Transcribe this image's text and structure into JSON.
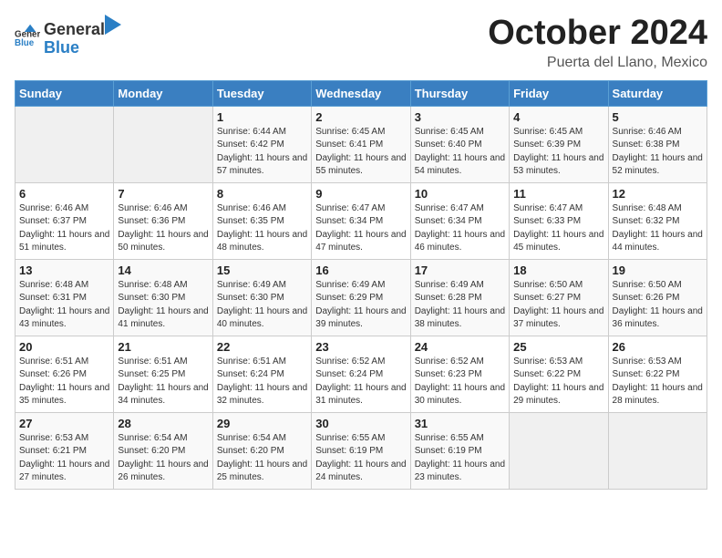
{
  "header": {
    "logo_general": "General",
    "logo_blue": "Blue",
    "month_title": "October 2024",
    "location": "Puerta del Llano, Mexico"
  },
  "weekdays": [
    "Sunday",
    "Monday",
    "Tuesday",
    "Wednesday",
    "Thursday",
    "Friday",
    "Saturday"
  ],
  "weeks": [
    [
      {
        "day": "",
        "info": ""
      },
      {
        "day": "",
        "info": ""
      },
      {
        "day": "1",
        "info": "Sunrise: 6:44 AM\nSunset: 6:42 PM\nDaylight: 11 hours and 57 minutes."
      },
      {
        "day": "2",
        "info": "Sunrise: 6:45 AM\nSunset: 6:41 PM\nDaylight: 11 hours and 55 minutes."
      },
      {
        "day": "3",
        "info": "Sunrise: 6:45 AM\nSunset: 6:40 PM\nDaylight: 11 hours and 54 minutes."
      },
      {
        "day": "4",
        "info": "Sunrise: 6:45 AM\nSunset: 6:39 PM\nDaylight: 11 hours and 53 minutes."
      },
      {
        "day": "5",
        "info": "Sunrise: 6:46 AM\nSunset: 6:38 PM\nDaylight: 11 hours and 52 minutes."
      }
    ],
    [
      {
        "day": "6",
        "info": "Sunrise: 6:46 AM\nSunset: 6:37 PM\nDaylight: 11 hours and 51 minutes."
      },
      {
        "day": "7",
        "info": "Sunrise: 6:46 AM\nSunset: 6:36 PM\nDaylight: 11 hours and 50 minutes."
      },
      {
        "day": "8",
        "info": "Sunrise: 6:46 AM\nSunset: 6:35 PM\nDaylight: 11 hours and 48 minutes."
      },
      {
        "day": "9",
        "info": "Sunrise: 6:47 AM\nSunset: 6:34 PM\nDaylight: 11 hours and 47 minutes."
      },
      {
        "day": "10",
        "info": "Sunrise: 6:47 AM\nSunset: 6:34 PM\nDaylight: 11 hours and 46 minutes."
      },
      {
        "day": "11",
        "info": "Sunrise: 6:47 AM\nSunset: 6:33 PM\nDaylight: 11 hours and 45 minutes."
      },
      {
        "day": "12",
        "info": "Sunrise: 6:48 AM\nSunset: 6:32 PM\nDaylight: 11 hours and 44 minutes."
      }
    ],
    [
      {
        "day": "13",
        "info": "Sunrise: 6:48 AM\nSunset: 6:31 PM\nDaylight: 11 hours and 43 minutes."
      },
      {
        "day": "14",
        "info": "Sunrise: 6:48 AM\nSunset: 6:30 PM\nDaylight: 11 hours and 41 minutes."
      },
      {
        "day": "15",
        "info": "Sunrise: 6:49 AM\nSunset: 6:30 PM\nDaylight: 11 hours and 40 minutes."
      },
      {
        "day": "16",
        "info": "Sunrise: 6:49 AM\nSunset: 6:29 PM\nDaylight: 11 hours and 39 minutes."
      },
      {
        "day": "17",
        "info": "Sunrise: 6:49 AM\nSunset: 6:28 PM\nDaylight: 11 hours and 38 minutes."
      },
      {
        "day": "18",
        "info": "Sunrise: 6:50 AM\nSunset: 6:27 PM\nDaylight: 11 hours and 37 minutes."
      },
      {
        "day": "19",
        "info": "Sunrise: 6:50 AM\nSunset: 6:26 PM\nDaylight: 11 hours and 36 minutes."
      }
    ],
    [
      {
        "day": "20",
        "info": "Sunrise: 6:51 AM\nSunset: 6:26 PM\nDaylight: 11 hours and 35 minutes."
      },
      {
        "day": "21",
        "info": "Sunrise: 6:51 AM\nSunset: 6:25 PM\nDaylight: 11 hours and 34 minutes."
      },
      {
        "day": "22",
        "info": "Sunrise: 6:51 AM\nSunset: 6:24 PM\nDaylight: 11 hours and 32 minutes."
      },
      {
        "day": "23",
        "info": "Sunrise: 6:52 AM\nSunset: 6:24 PM\nDaylight: 11 hours and 31 minutes."
      },
      {
        "day": "24",
        "info": "Sunrise: 6:52 AM\nSunset: 6:23 PM\nDaylight: 11 hours and 30 minutes."
      },
      {
        "day": "25",
        "info": "Sunrise: 6:53 AM\nSunset: 6:22 PM\nDaylight: 11 hours and 29 minutes."
      },
      {
        "day": "26",
        "info": "Sunrise: 6:53 AM\nSunset: 6:22 PM\nDaylight: 11 hours and 28 minutes."
      }
    ],
    [
      {
        "day": "27",
        "info": "Sunrise: 6:53 AM\nSunset: 6:21 PM\nDaylight: 11 hours and 27 minutes."
      },
      {
        "day": "28",
        "info": "Sunrise: 6:54 AM\nSunset: 6:20 PM\nDaylight: 11 hours and 26 minutes."
      },
      {
        "day": "29",
        "info": "Sunrise: 6:54 AM\nSunset: 6:20 PM\nDaylight: 11 hours and 25 minutes."
      },
      {
        "day": "30",
        "info": "Sunrise: 6:55 AM\nSunset: 6:19 PM\nDaylight: 11 hours and 24 minutes."
      },
      {
        "day": "31",
        "info": "Sunrise: 6:55 AM\nSunset: 6:19 PM\nDaylight: 11 hours and 23 minutes."
      },
      {
        "day": "",
        "info": ""
      },
      {
        "day": "",
        "info": ""
      }
    ]
  ]
}
